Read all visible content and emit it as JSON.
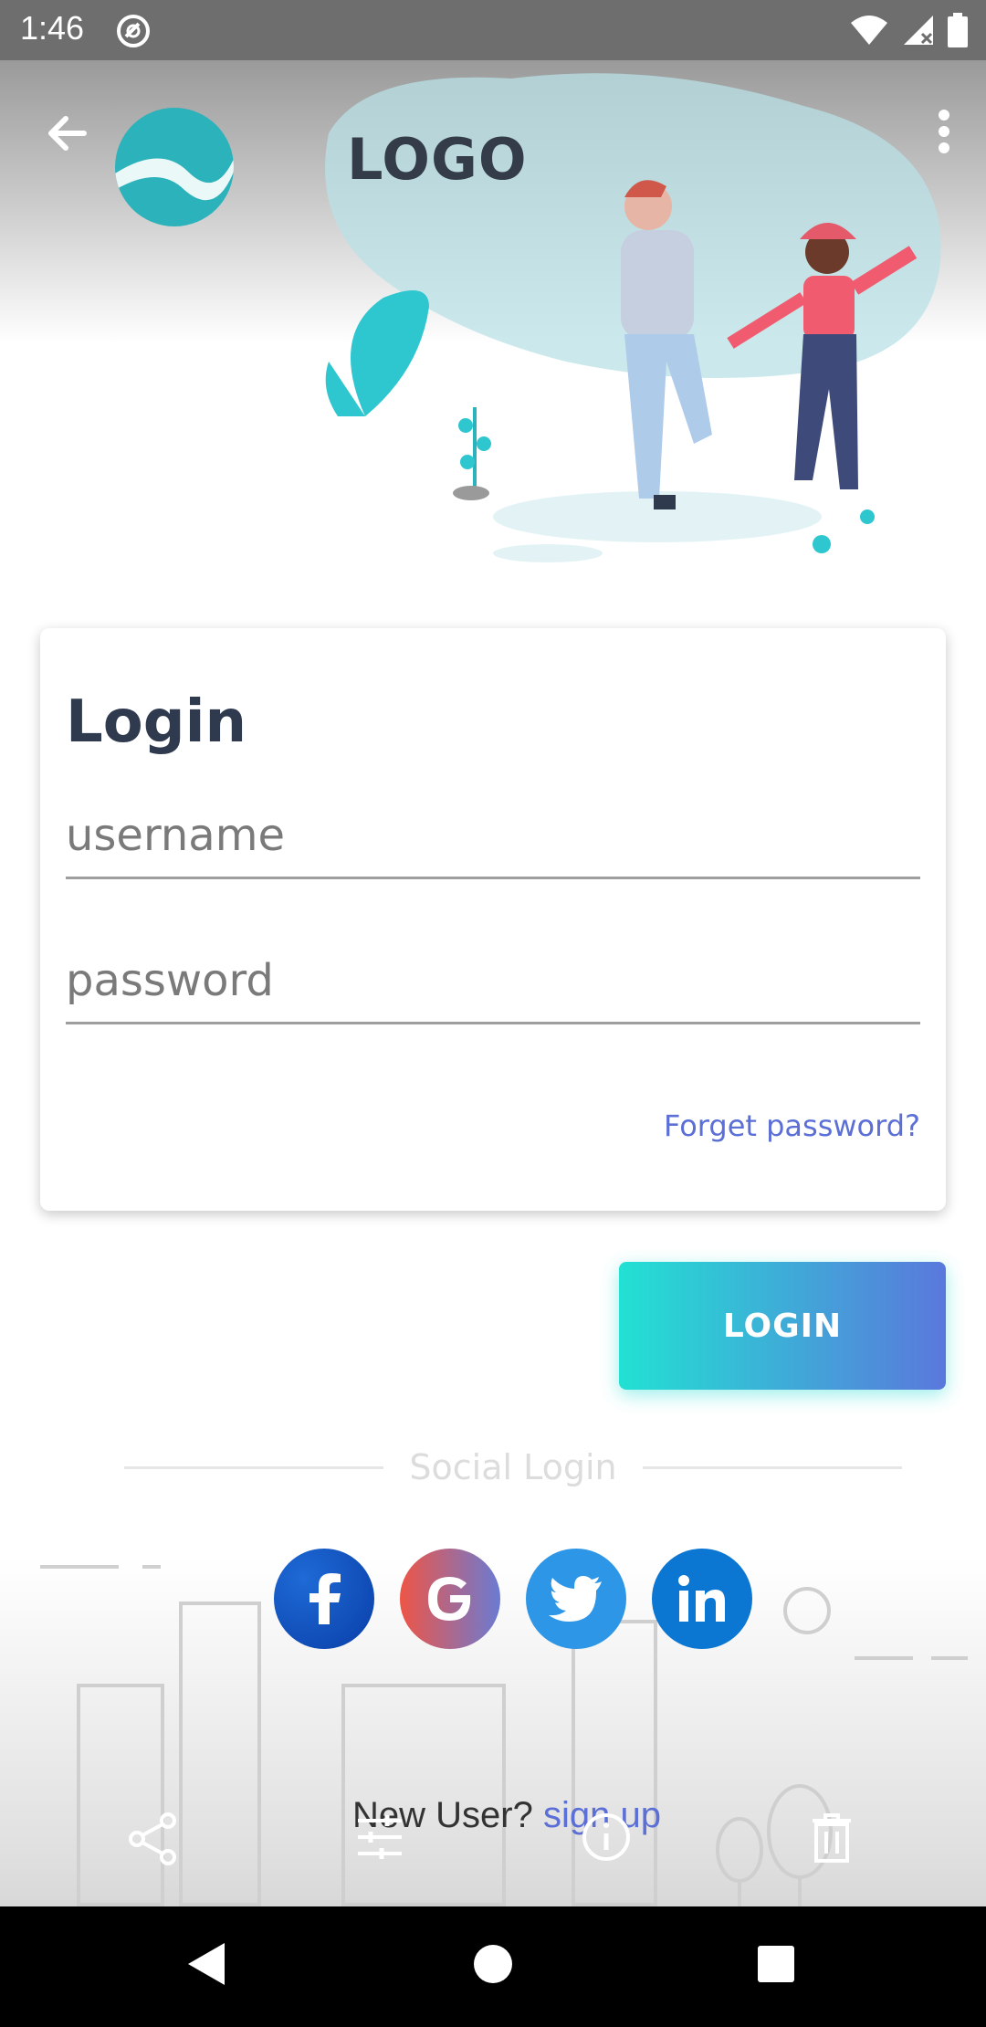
{
  "status_bar": {
    "time": "1:46",
    "icons": [
      "sync-icon",
      "wifi-icon",
      "signal-icon",
      "battery-icon"
    ]
  },
  "header": {
    "logo_text": "LOGO",
    "back_icon": "arrow-left-icon",
    "menu_icon": "more-vertical-icon"
  },
  "login_card": {
    "title": "Login",
    "username_placeholder": "username",
    "password_placeholder": "password",
    "forgot_password": "Forget password?"
  },
  "login_button": {
    "label": "LOGIN"
  },
  "social": {
    "divider_label": "Social Login",
    "providers": [
      "facebook",
      "google",
      "twitter",
      "linkedin"
    ]
  },
  "signup": {
    "prompt": "New User? ",
    "link": "sign up"
  },
  "bottom_toolbar": {
    "icons": [
      "share-icon",
      "tune-icon",
      "info-icon",
      "delete-icon"
    ]
  },
  "nav_bar": {
    "icons": [
      "back-triangle-icon",
      "home-circle-icon",
      "recents-square-icon"
    ]
  },
  "colors": {
    "accent": "#5b6fd6",
    "teal": "#22e1d3",
    "title": "#2f3a4f"
  }
}
